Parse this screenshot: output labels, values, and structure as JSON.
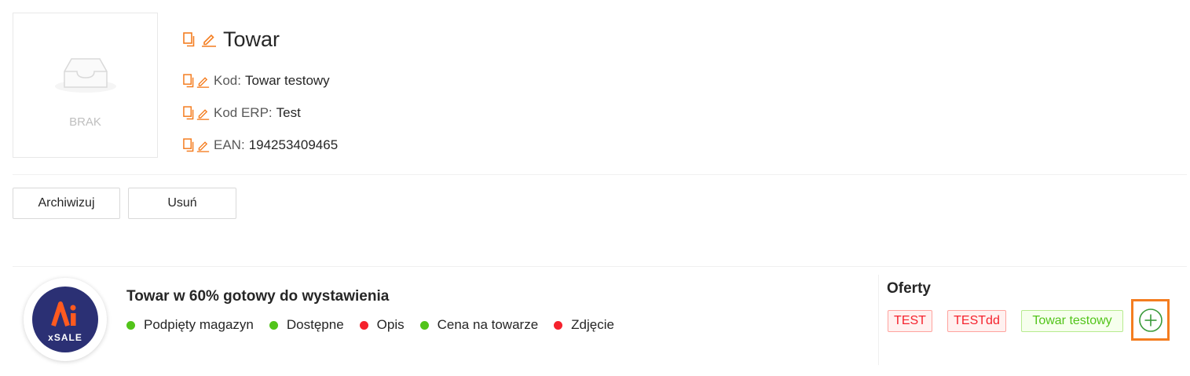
{
  "product": {
    "image_placeholder": "BRAK",
    "title": "Towar",
    "fields": [
      {
        "label": "Kod:",
        "value": "Towar testowy"
      },
      {
        "label": "Kod ERP:",
        "value": "Test"
      },
      {
        "label": "EAN:",
        "value": "194253409465"
      }
    ]
  },
  "actions": {
    "archive_label": "Archiwizuj",
    "delete_label": "Usuń"
  },
  "readiness": {
    "logo_text": "xSALE",
    "title": "Towar w 60% gotowy do wystawienia",
    "percent": 60,
    "items": [
      {
        "label": "Podpięty magazyn",
        "status": "ok"
      },
      {
        "label": "Dostępne",
        "status": "ok"
      },
      {
        "label": "Opis",
        "status": "missing"
      },
      {
        "label": "Cena na towarze",
        "status": "ok"
      },
      {
        "label": "Zdjęcie",
        "status": "missing"
      }
    ]
  },
  "offers": {
    "title": "Oferty",
    "tags": [
      {
        "label": "TEST",
        "color": "red"
      },
      {
        "label": "TESTdd",
        "color": "red"
      },
      {
        "label": "Towar testowy",
        "color": "green"
      }
    ]
  },
  "colors": {
    "accent": "#f47d20",
    "ok": "#52c41a",
    "missing": "#f5222d",
    "brand_navy": "#2b3074",
    "add_icon": "#3a9a3a"
  },
  "icons": {
    "copy": "copy-icon",
    "edit": "edit-icon",
    "add": "plus-circle-icon",
    "empty": "empty-inbox-icon"
  }
}
